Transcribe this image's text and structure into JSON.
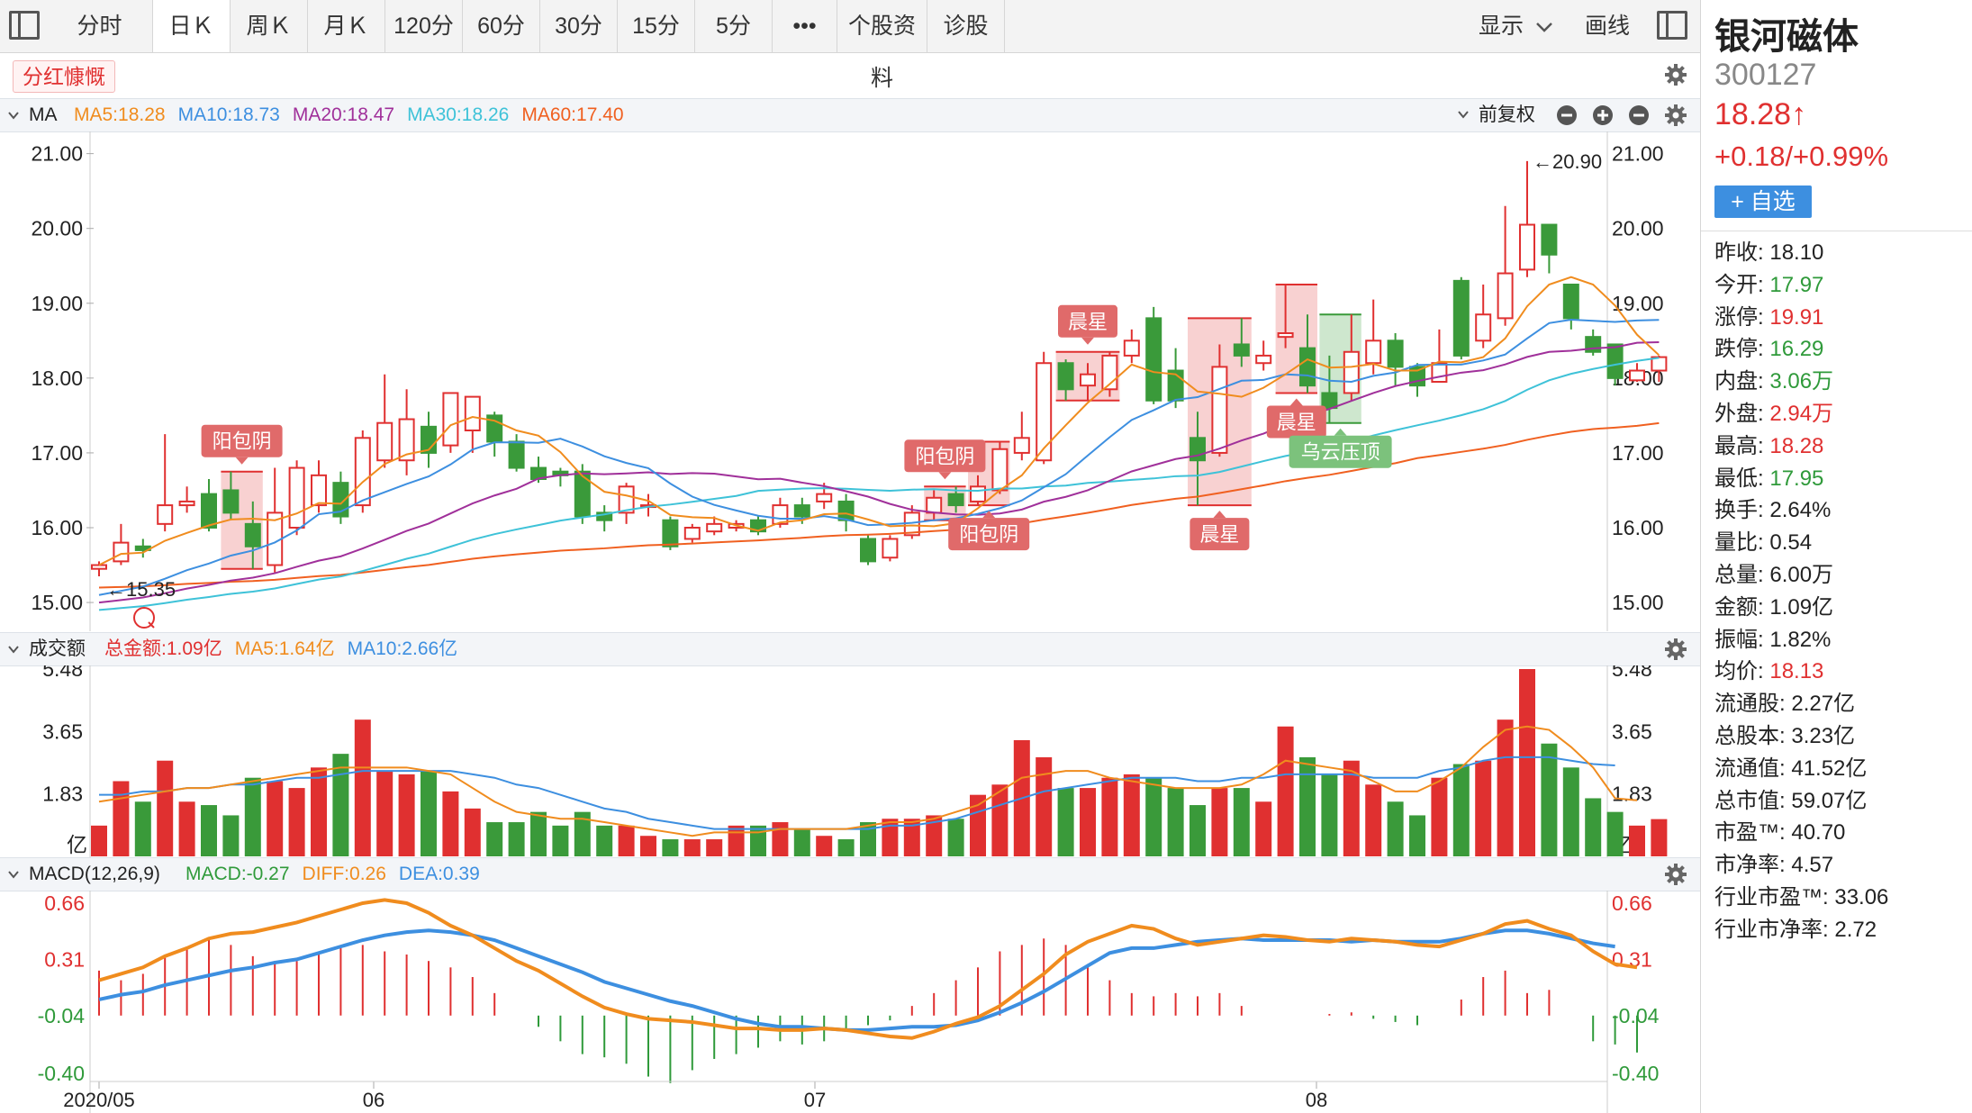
{
  "toolbar": {
    "tabs": [
      {
        "label": "分时",
        "active": false
      },
      {
        "label": "日Ｋ",
        "active": true
      },
      {
        "label": "周Ｋ",
        "active": false
      },
      {
        "label": "月Ｋ",
        "active": false
      },
      {
        "label": "120分",
        "active": false
      },
      {
        "label": "60分",
        "active": false
      },
      {
        "label": "30分",
        "active": false
      },
      {
        "label": "15分",
        "active": false
      },
      {
        "label": "5分",
        "active": false
      },
      {
        "label": "•••",
        "active": false
      },
      {
        "label": "个股资料",
        "active": false
      },
      {
        "label": "诊股",
        "active": false
      }
    ],
    "display_label": "显示",
    "draw_label": "画线"
  },
  "notice": {
    "label": "分红慷慨"
  },
  "ma_header": {
    "title": "MA",
    "items": [
      {
        "text": "MA5:18.28",
        "color": "#f08c1e"
      },
      {
        "text": "MA10:18.73",
        "color": "#3d8fe0"
      },
      {
        "text": "MA20:18.47",
        "color": "#a0309a"
      },
      {
        "text": "MA30:18.26",
        "color": "#3ec2d8"
      },
      {
        "text": "MA60:17.40",
        "color": "#f06020"
      }
    ],
    "adjust_label": "前复权"
  },
  "volume_header": {
    "title": "成交额",
    "items": [
      {
        "text": "总金额:1.09亿",
        "color": "#e03030"
      },
      {
        "text": "MA5:1.64亿",
        "color": "#f08c1e"
      },
      {
        "text": "MA10:2.66亿",
        "color": "#3d8fe0"
      }
    ]
  },
  "macd_header": {
    "title": "MACD(12,26,9)",
    "items": [
      {
        "text": "MACD:-0.27",
        "color": "#2f9a3a"
      },
      {
        "text": "DIFF:0.26",
        "color": "#f08c1e"
      },
      {
        "text": "DEA:0.39",
        "color": "#3d8fe0"
      }
    ]
  },
  "colors": {
    "up": "#e03030",
    "down": "#3a9a3a",
    "ma5": "#f08c1e",
    "ma10": "#3d8fe0",
    "ma20": "#a0309a",
    "ma30": "#3ec2d8",
    "ma60": "#f06020"
  },
  "chart_data": [
    {
      "type": "candlestick",
      "title": "",
      "y_ticks": [
        "21.00",
        "20.00",
        "19.00",
        "18.00",
        "17.00",
        "16.00",
        "15.00"
      ],
      "ylim": [
        14.7,
        21.2
      ],
      "x_labels": [
        "2020/05",
        "06",
        "07",
        "08"
      ],
      "high_marker": "←20.90",
      "low_marker": "←15.35",
      "candles": [
        [
          15.45,
          15.5,
          15.55,
          15.35
        ],
        [
          15.55,
          15.8,
          16.05,
          15.5
        ],
        [
          15.75,
          15.7,
          15.85,
          15.6
        ],
        [
          16.05,
          16.3,
          17.25,
          15.95
        ],
        [
          16.3,
          16.35,
          16.55,
          16.2
        ],
        [
          16.45,
          16.0,
          16.65,
          15.95
        ],
        [
          16.5,
          16.2,
          16.75,
          16.1
        ],
        [
          16.05,
          15.75,
          16.35,
          15.45
        ],
        [
          15.5,
          16.2,
          16.8,
          15.4
        ],
        [
          16.0,
          16.8,
          16.9,
          15.9
        ],
        [
          16.3,
          16.7,
          16.9,
          16.2
        ],
        [
          16.6,
          16.15,
          16.75,
          16.05
        ],
        [
          16.3,
          17.2,
          17.3,
          16.2
        ],
        [
          16.9,
          17.4,
          18.05,
          16.8
        ],
        [
          16.9,
          17.45,
          17.85,
          16.7
        ],
        [
          17.35,
          17.0,
          17.55,
          16.8
        ],
        [
          17.1,
          17.8,
          17.8,
          17.0
        ],
        [
          17.3,
          17.75,
          17.75,
          17.0
        ],
        [
          17.5,
          17.15,
          17.55,
          16.95
        ],
        [
          17.15,
          16.8,
          17.25,
          16.75
        ],
        [
          16.8,
          16.65,
          16.95,
          16.6
        ],
        [
          16.75,
          16.7,
          16.8,
          16.55
        ],
        [
          16.75,
          16.15,
          16.85,
          16.05
        ],
        [
          16.2,
          16.1,
          16.3,
          15.95
        ],
        [
          16.2,
          16.55,
          16.6,
          16.05
        ],
        [
          16.3,
          16.3,
          16.45,
          16.15
        ],
        [
          16.1,
          15.75,
          16.15,
          15.7
        ],
        [
          15.85,
          16.0,
          16.05,
          15.8
        ],
        [
          15.95,
          16.05,
          16.15,
          15.9
        ],
        [
          16.0,
          16.05,
          16.1,
          15.95
        ],
        [
          16.1,
          15.95,
          16.15,
          15.9
        ],
        [
          16.05,
          16.3,
          16.4,
          16.0
        ],
        [
          16.3,
          16.15,
          16.4,
          16.05
        ],
        [
          16.35,
          16.45,
          16.6,
          16.25
        ],
        [
          16.35,
          16.1,
          16.45,
          15.95
        ],
        [
          15.85,
          15.55,
          15.9,
          15.5
        ],
        [
          15.6,
          15.85,
          15.9,
          15.55
        ],
        [
          15.9,
          16.2,
          16.3,
          15.85
        ],
        [
          16.2,
          16.4,
          16.5,
          16.1
        ],
        [
          16.45,
          16.3,
          16.55,
          16.2
        ],
        [
          16.35,
          16.55,
          16.7,
          16.3
        ],
        [
          16.5,
          17.05,
          17.15,
          16.45
        ],
        [
          17.0,
          17.2,
          17.55,
          16.9
        ],
        [
          16.9,
          18.2,
          18.35,
          16.85
        ],
        [
          18.2,
          17.85,
          18.25,
          17.7
        ],
        [
          17.9,
          18.05,
          18.2,
          17.7
        ],
        [
          17.85,
          18.3,
          18.35,
          17.75
        ],
        [
          18.3,
          18.5,
          18.65,
          18.2
        ],
        [
          18.8,
          17.7,
          18.95,
          17.65
        ],
        [
          18.1,
          17.7,
          18.4,
          17.6
        ],
        [
          17.2,
          16.9,
          17.55,
          16.3
        ],
        [
          17.0,
          18.15,
          18.45,
          16.95
        ],
        [
          18.45,
          18.3,
          18.8,
          18.15
        ],
        [
          18.2,
          18.3,
          18.5,
          18.1
        ],
        [
          18.55,
          18.6,
          19.25,
          18.4
        ],
        [
          18.4,
          17.9,
          18.85,
          17.8
        ],
        [
          17.8,
          17.6,
          18.3,
          17.4
        ],
        [
          17.8,
          18.35,
          18.85,
          17.7
        ],
        [
          18.2,
          18.5,
          19.05,
          18.05
        ],
        [
          18.5,
          18.15,
          18.6,
          17.9
        ],
        [
          18.15,
          17.9,
          18.2,
          17.75
        ],
        [
          17.95,
          18.2,
          18.65,
          17.95
        ],
        [
          19.3,
          18.3,
          19.35,
          18.25
        ],
        [
          18.5,
          18.85,
          19.25,
          18.4
        ],
        [
          18.8,
          19.4,
          20.3,
          18.7
        ],
        [
          19.45,
          20.05,
          20.9,
          19.35
        ],
        [
          20.05,
          19.65,
          20.05,
          19.4
        ],
        [
          19.25,
          18.8,
          19.25,
          18.65
        ],
        [
          18.55,
          18.35,
          18.65,
          18.3
        ],
        [
          18.45,
          18.0,
          18.45,
          17.9
        ],
        [
          17.97,
          18.1,
          18.2,
          17.95
        ],
        [
          18.1,
          18.28,
          18.3,
          17.95
        ]
      ],
      "patterns": [
        {
          "label": "阳包阴",
          "style": "red",
          "from": 6,
          "to": 7
        },
        {
          "label": "阳包阴",
          "style": "red",
          "from": 38,
          "to": 39
        },
        {
          "label": "阳包阴",
          "style": "red",
          "from": 40,
          "to": 41
        },
        {
          "label": "晨星",
          "style": "red",
          "from": 44,
          "to": 46
        },
        {
          "label": "晨星",
          "style": "red",
          "from": 50,
          "to": 52
        },
        {
          "label": "晨星",
          "style": "red",
          "from": 54,
          "to": 55
        },
        {
          "label": "乌云压顶",
          "style": "green",
          "from": 56,
          "to": 57
        }
      ]
    },
    {
      "type": "bar",
      "title": "成交额",
      "unit": "亿",
      "y_ticks": [
        "5.48",
        "3.65",
        "1.83"
      ],
      "ylim": [
        0,
        5.48
      ],
      "values": [
        0.9,
        2.2,
        1.6,
        2.8,
        1.6,
        1.5,
        1.2,
        2.3,
        2.2,
        2.0,
        2.6,
        3.0,
        4.0,
        2.5,
        2.4,
        2.5,
        1.9,
        1.4,
        1.0,
        1.0,
        1.3,
        0.9,
        1.3,
        0.9,
        0.9,
        0.6,
        0.5,
        0.5,
        0.5,
        0.9,
        0.9,
        1.0,
        0.8,
        0.6,
        0.5,
        1.0,
        1.1,
        1.1,
        1.2,
        1.1,
        1.8,
        2.1,
        3.4,
        2.9,
        2.0,
        2.0,
        2.3,
        2.4,
        2.3,
        2.0,
        1.5,
        2.0,
        2.0,
        1.6,
        3.8,
        2.9,
        2.4,
        2.8,
        2.1,
        1.6,
        1.2,
        2.3,
        2.7,
        2.8,
        4.0,
        5.48,
        3.3,
        2.6,
        1.7,
        1.3,
        0.9,
        1.09
      ],
      "ma5": [
        1.6,
        1.7,
        1.8,
        1.9,
        2.0,
        2.0,
        2.1,
        2.2,
        2.3,
        2.4,
        2.5,
        2.6,
        2.6,
        2.6,
        2.6,
        2.5,
        2.4,
        2.0,
        1.6,
        1.3,
        1.2,
        1.1,
        1.1,
        1.0,
        0.9,
        0.8,
        0.7,
        0.6,
        0.7,
        0.7,
        0.7,
        0.8,
        0.8,
        0.8,
        0.8,
        0.9,
        1.0,
        1.0,
        1.1,
        1.3,
        1.5,
        1.9,
        2.3,
        2.4,
        2.5,
        2.5,
        2.3,
        2.2,
        2.1,
        2.0,
        2.0,
        2.0,
        2.1,
        2.4,
        2.8,
        2.7,
        2.6,
        2.5,
        2.2,
        1.9,
        1.9,
        2.2,
        2.6,
        3.2,
        3.7,
        3.8,
        3.7,
        3.2,
        2.6,
        1.7,
        1.64
      ],
      "ma10": [
        1.8,
        1.8,
        1.9,
        1.9,
        2.0,
        2.0,
        2.1,
        2.1,
        2.2,
        2.3,
        2.3,
        2.4,
        2.5,
        2.5,
        2.5,
        2.5,
        2.5,
        2.4,
        2.3,
        2.1,
        2.0,
        1.8,
        1.6,
        1.4,
        1.3,
        1.1,
        1.0,
        0.9,
        0.8,
        0.8,
        0.8,
        0.8,
        0.8,
        0.8,
        0.8,
        0.8,
        0.9,
        0.9,
        1.0,
        1.1,
        1.3,
        1.5,
        1.7,
        1.9,
        2.0,
        2.1,
        2.2,
        2.3,
        2.3,
        2.3,
        2.2,
        2.2,
        2.3,
        2.3,
        2.4,
        2.4,
        2.4,
        2.4,
        2.3,
        2.3,
        2.3,
        2.5,
        2.6,
        2.8,
        2.9,
        2.9,
        2.9,
        2.8,
        2.7,
        2.66
      ]
    },
    {
      "type": "bar",
      "title": "MACD(12,26,9)",
      "y_ticks": [
        "0.66",
        "0.31",
        "-0.04",
        "-0.40"
      ],
      "ylim": [
        -0.4,
        0.66
      ],
      "hist": [
        0.24,
        0.18,
        0.22,
        0.32,
        0.39,
        0.44,
        0.4,
        0.33,
        0.3,
        0.3,
        0.36,
        0.38,
        0.4,
        0.36,
        0.34,
        0.3,
        0.26,
        0.2,
        0.1,
        -0.04,
        -0.11,
        -0.2,
        -0.28,
        -0.3,
        -0.34,
        -0.42,
        -0.46,
        -0.38,
        -0.31,
        -0.28,
        -0.24,
        -0.2,
        -0.22,
        -0.2,
        -0.14,
        -0.1,
        -0.07,
        0.02,
        0.1,
        0.18,
        0.26,
        0.36,
        0.4,
        0.44,
        0.4,
        0.28,
        0.18,
        0.1,
        0.08,
        0.1,
        0.08,
        0.1,
        0.02,
        -0.04,
        -0.04,
        -0.04,
        -0.03,
        -0.02,
        -0.06,
        -0.08,
        -0.1,
        -0.04,
        0.06,
        0.2,
        0.24,
        0.1,
        0.12,
        -0.04,
        -0.2,
        -0.22,
        -0.27
      ],
      "diff": [
        0.18,
        0.22,
        0.26,
        0.33,
        0.38,
        0.44,
        0.47,
        0.48,
        0.51,
        0.54,
        0.58,
        0.62,
        0.66,
        0.68,
        0.66,
        0.6,
        0.52,
        0.46,
        0.38,
        0.3,
        0.24,
        0.16,
        0.08,
        0.01,
        -0.03,
        -0.06,
        -0.07,
        -0.08,
        -0.1,
        -0.12,
        -0.12,
        -0.13,
        -0.13,
        -0.12,
        -0.13,
        -0.15,
        -0.17,
        -0.18,
        -0.14,
        -0.09,
        -0.05,
        0.02,
        0.12,
        0.22,
        0.34,
        0.42,
        0.47,
        0.52,
        0.5,
        0.44,
        0.4,
        0.42,
        0.44,
        0.46,
        0.45,
        0.43,
        0.42,
        0.44,
        0.43,
        0.42,
        0.4,
        0.39,
        0.43,
        0.47,
        0.53,
        0.55,
        0.5,
        0.46,
        0.36,
        0.28,
        0.26
      ],
      "dea": [
        0.06,
        0.09,
        0.11,
        0.15,
        0.18,
        0.21,
        0.24,
        0.26,
        0.29,
        0.31,
        0.35,
        0.39,
        0.43,
        0.46,
        0.48,
        0.49,
        0.48,
        0.46,
        0.43,
        0.38,
        0.33,
        0.28,
        0.23,
        0.17,
        0.13,
        0.09,
        0.05,
        0.02,
        -0.02,
        -0.06,
        -0.09,
        -0.11,
        -0.11,
        -0.12,
        -0.13,
        -0.13,
        -0.12,
        -0.11,
        -0.11,
        -0.1,
        -0.07,
        -0.02,
        0.04,
        0.11,
        0.19,
        0.27,
        0.35,
        0.38,
        0.38,
        0.4,
        0.42,
        0.43,
        0.44,
        0.43,
        0.43,
        0.43,
        0.43,
        0.42,
        0.43,
        0.42,
        0.42,
        0.42,
        0.44,
        0.47,
        0.49,
        0.49,
        0.47,
        0.44,
        0.41,
        0.39
      ]
    }
  ],
  "quote": {
    "name": "银河磁体",
    "code": "300127",
    "price": "18.28↑",
    "change": "+0.18/+0.99%",
    "add_label": "+ 自选",
    "rows": [
      {
        "label": "昨收:",
        "value": "18.10",
        "color": "#222"
      },
      {
        "label": "今开:",
        "value": "17.97",
        "color": "#2f9a3a"
      },
      {
        "label": "涨停:",
        "value": "19.91",
        "color": "#e03030"
      },
      {
        "label": "跌停:",
        "value": "16.29",
        "color": "#2f9a3a"
      },
      {
        "label": "内盘:",
        "value": "3.06万",
        "color": "#2f9a3a"
      },
      {
        "label": "外盘:",
        "value": "2.94万",
        "color": "#e03030"
      },
      {
        "label": "最高:",
        "value": "18.28",
        "color": "#e03030"
      },
      {
        "label": "最低:",
        "value": "17.95",
        "color": "#2f9a3a"
      },
      {
        "label": "换手:",
        "value": "2.64%",
        "color": "#222"
      },
      {
        "label": "量比:",
        "value": "0.54",
        "color": "#222"
      },
      {
        "label": "总量:",
        "value": "6.00万",
        "color": "#222"
      },
      {
        "label": "金额:",
        "value": "1.09亿",
        "color": "#222"
      },
      {
        "label": "振幅:",
        "value": "1.82%",
        "color": "#222"
      },
      {
        "label": "均价:",
        "value": "18.13",
        "color": "#e03030"
      },
      {
        "label": "流通股:",
        "value": "2.27亿",
        "color": "#222"
      },
      {
        "label": "总股本:",
        "value": "3.23亿",
        "color": "#222"
      },
      {
        "label": "流通值:",
        "value": "41.52亿",
        "color": "#222"
      },
      {
        "label": "总市值:",
        "value": "59.07亿",
        "color": "#222"
      },
      {
        "label": "市盈™:",
        "value": "40.70",
        "color": "#222"
      },
      {
        "label": "市净率:",
        "value": "4.57",
        "color": "#222"
      },
      {
        "label": "行业市盈™:",
        "value": "33.06",
        "color": "#222"
      },
      {
        "label": "行业市净率:",
        "value": "2.72",
        "color": "#222"
      }
    ]
  }
}
